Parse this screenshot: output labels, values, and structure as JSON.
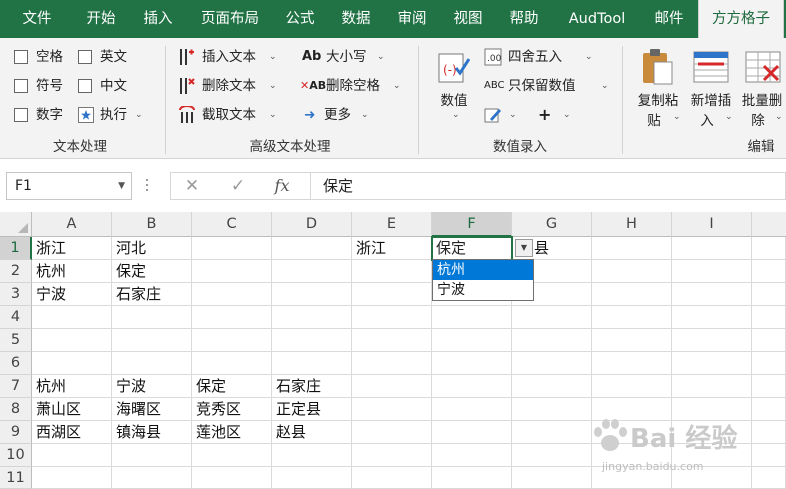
{
  "tabs": [
    "文件",
    "开始",
    "插入",
    "页面布局",
    "公式",
    "数据",
    "审阅",
    "视图",
    "帮助",
    "AudTool",
    "邮件",
    "方方格子"
  ],
  "active_tab_index": 11,
  "ribbon": {
    "text_processing": {
      "label": "文本处理",
      "checkboxes": [
        "空格",
        "英文",
        "符号",
        "中文",
        "数字"
      ],
      "execute": "执行"
    },
    "advanced_text": {
      "label": "高级文本处理",
      "insert_text": "插入文本",
      "delete_text": "删除文本",
      "truncate_text": "截取文本",
      "case": "大小写",
      "delete_spaces": "删除空格",
      "more": "更多"
    },
    "numeric_entry": {
      "label": "数值录入",
      "numeric": "数值",
      "rounding": "四舍五入",
      "keep_values": "只保留数值",
      "plus": "+"
    },
    "edit": {
      "label": "编辑",
      "copy_paste": [
        "复制粘",
        "贴"
      ],
      "add_insert": [
        "新增插",
        "入"
      ],
      "batch_delete": [
        "批量删",
        "除"
      ]
    }
  },
  "formula_bar": {
    "name_box": "F1",
    "cancel": "✕",
    "confirm": "✓",
    "fx": "fx",
    "value": "保定"
  },
  "columns": [
    "A",
    "B",
    "C",
    "D",
    "E",
    "F",
    "G",
    "H",
    "I"
  ],
  "rows": [
    "1",
    "2",
    "3",
    "4",
    "5",
    "6",
    "7",
    "8",
    "9",
    "10",
    "11"
  ],
  "cells": {
    "A1": "浙江",
    "B1": "河北",
    "E1": "浙江",
    "F1": "保定",
    "G1": "县",
    "A2": "杭州",
    "B2": "保定",
    "A3": "宁波",
    "B3": "石家庄",
    "A7": "杭州",
    "B7": "宁波",
    "C7": "保定",
    "D7": "石家庄",
    "A8": "萧山区",
    "B8": "海曙区",
    "C8": "竞秀区",
    "D8": "正定县",
    "A9": "西湖区",
    "B9": "镇海县",
    "C9": "莲池区",
    "D9": "赵县"
  },
  "dropdown": {
    "options": [
      "杭州",
      "宁波"
    ],
    "highlighted": "杭州"
  },
  "watermark": {
    "brand": "Bai 经验",
    "url": "jingyan.baidu.com"
  },
  "colors": {
    "excel_green": "#217346",
    "selection_blue": "#0078d7"
  }
}
